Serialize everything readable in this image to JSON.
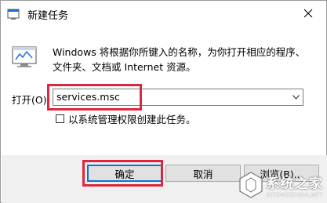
{
  "window": {
    "title": "新建任务"
  },
  "description": "Windows 将根据你所键入的名称，为你打开相应的程序、文件夹、文档或 Internet 资源。",
  "open": {
    "label": "打开(O):",
    "value": "services.msc"
  },
  "checkbox": {
    "label": "以系统管理权限创建此任务。",
    "checked": false
  },
  "buttons": {
    "ok": "确定",
    "cancel": "取消",
    "browse": "浏览(B)..."
  },
  "watermark": {
    "cn": "系统之家",
    "en": "XITONGZHIJIA.NET"
  },
  "colors": {
    "highlight": "#e0263e",
    "focus": "#0078d7",
    "bottom_bar": "#f0f0f0"
  },
  "icons": [
    "run-app-icon",
    "close-icon",
    "run-dialog-icon",
    "dropdown-arrow-icon",
    "watermark-logo-icon"
  ]
}
